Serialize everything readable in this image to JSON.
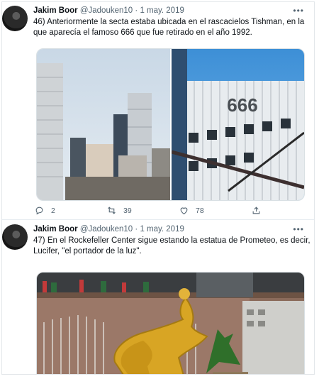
{
  "tweets": [
    {
      "author_name": "Jakim Boor",
      "handle": "@Jadouken10",
      "separator": "·",
      "date": "1 may. 2019",
      "text": "46) Anteriormente la secta estaba ubicada en el rascacielos Tishman, en la que aparecía el famoso 666 que fue retirado en el año 1992.",
      "image_text": "666",
      "actions": {
        "replies": "2",
        "retweets": "39",
        "likes": "78"
      }
    },
    {
      "author_name": "Jakim Boor",
      "handle": "@Jadouken10",
      "separator": "·",
      "date": "1 may. 2019",
      "text": "47) En el Rockefeller Center sigue estando la estatua de Prometeo, es decir, Lucifer, \"el portador de la luz\"."
    }
  ],
  "icons": [
    "more-icon",
    "reply-icon",
    "retweet-icon",
    "like-icon",
    "share-icon"
  ],
  "colors": {
    "text": "#0f1419",
    "secondary": "#536471",
    "border": "#e3e7ea"
  }
}
